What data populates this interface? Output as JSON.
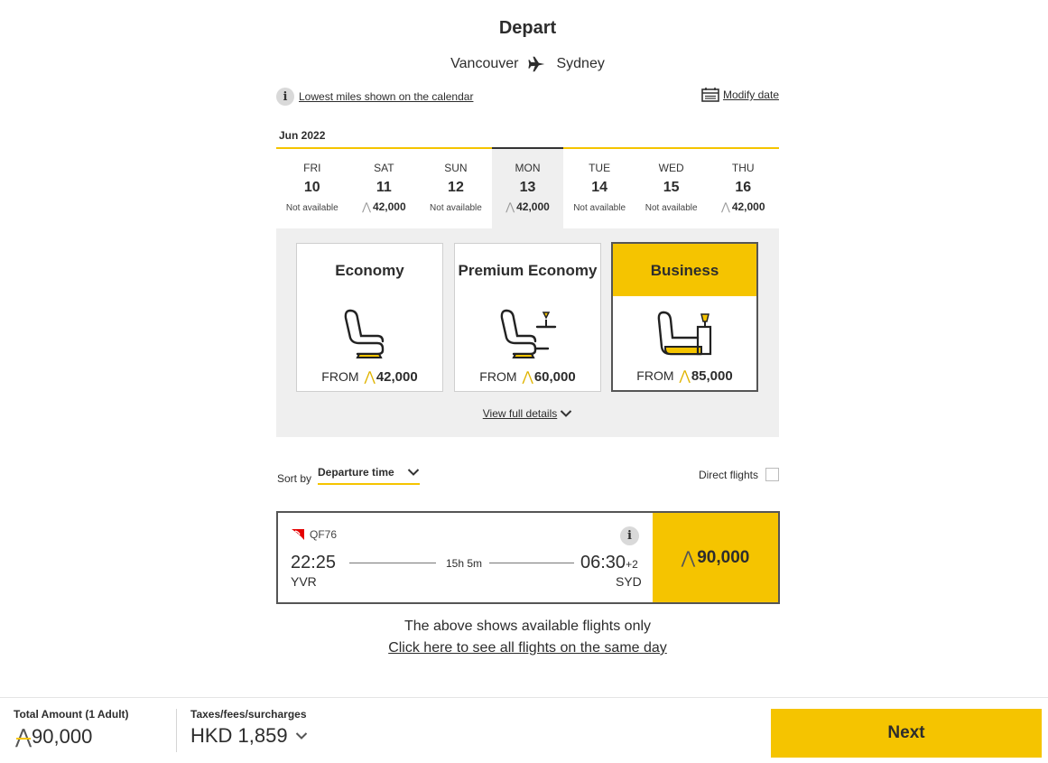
{
  "header": {
    "title": "Depart",
    "origin": "Vancouver",
    "destination": "Sydney"
  },
  "info": {
    "calendar_note": "Lowest miles shown on the calendar",
    "modify_date": "Modify date"
  },
  "calendar": {
    "month": "Jun 2022",
    "days": [
      {
        "dow": "FRI",
        "date": "10",
        "status": "Not available",
        "miles": ""
      },
      {
        "dow": "SAT",
        "date": "11",
        "status": "",
        "miles": "42,000"
      },
      {
        "dow": "SUN",
        "date": "12",
        "status": "Not available",
        "miles": ""
      },
      {
        "dow": "MON",
        "date": "13",
        "status": "",
        "miles": "42,000",
        "selected": true
      },
      {
        "dow": "TUE",
        "date": "14",
        "status": "Not available",
        "miles": ""
      },
      {
        "dow": "WED",
        "date": "15",
        "status": "Not available",
        "miles": ""
      },
      {
        "dow": "THU",
        "date": "16",
        "status": "",
        "miles": "42,000"
      }
    ]
  },
  "cabins": {
    "economy": {
      "name": "Economy",
      "from_label": "FROM",
      "miles": "42,000"
    },
    "premium": {
      "name": "Premium Economy",
      "from_label": "FROM",
      "miles": "60,000"
    },
    "business": {
      "name": "Business",
      "from_label": "FROM",
      "miles": "85,000",
      "selected": true
    },
    "view_details": "View full details"
  },
  "sort": {
    "label": "Sort by",
    "value": "Departure time",
    "direct_label": "Direct flights"
  },
  "flight": {
    "number": "QF76",
    "depart_time": "22:25",
    "depart_code": "YVR",
    "duration": "15h 5m",
    "arrive_time": "06:30",
    "arrive_offset": "+2",
    "arrive_code": "SYD",
    "price": "90,000"
  },
  "notes": {
    "available_only": "The above shows available flights only",
    "see_all": "Click here to see all flights on the same day"
  },
  "footer": {
    "total_label": "Total Amount (1 Adult)",
    "total_value": "90,000",
    "tax_label": "Taxes/fees/surcharges",
    "tax_value": "HKD 1,859",
    "next": "Next"
  },
  "colors": {
    "accent": "#f5c400",
    "panel": "#efefef",
    "text": "#2d2d2d"
  }
}
